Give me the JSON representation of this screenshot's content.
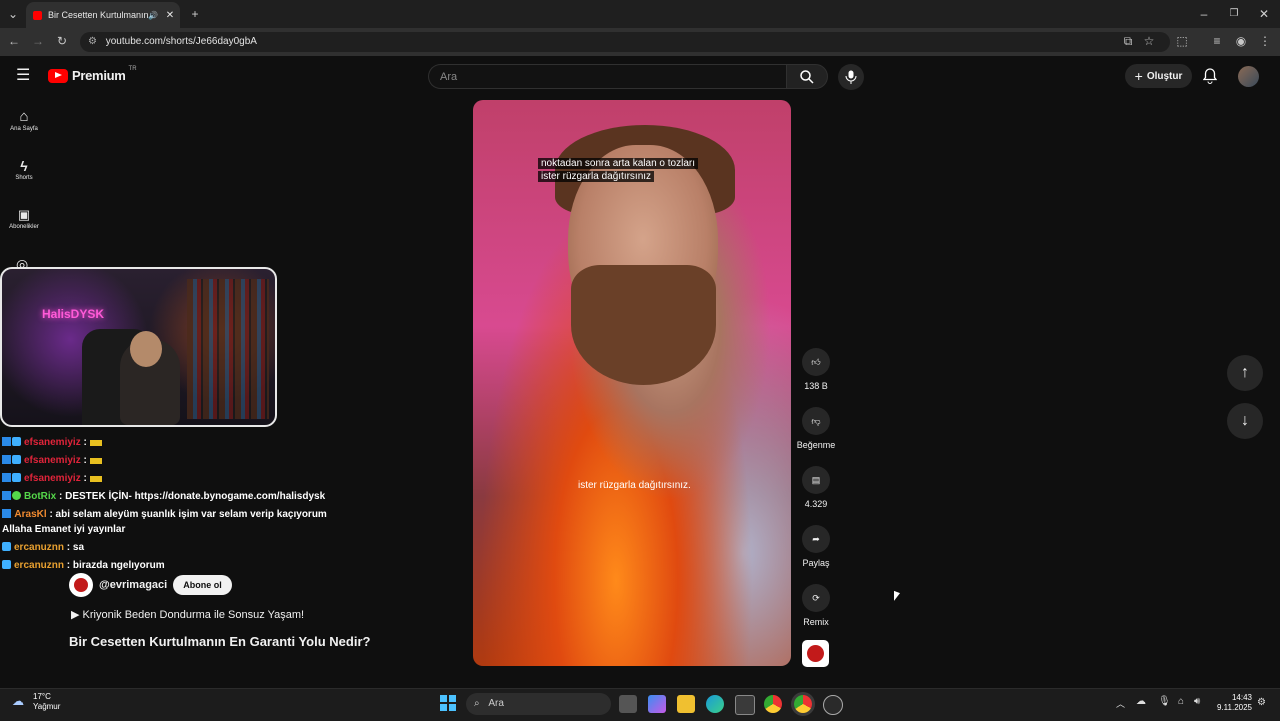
{
  "browser": {
    "tab_title": "Bir Cesetten Kurtulmanın En",
    "url": "youtube.com/shorts/Je66day0gbA"
  },
  "youtube": {
    "logo_text": "Premium",
    "region": "TR",
    "search_placeholder": "Ara",
    "create_label": "Oluştur",
    "nav": [
      {
        "label": "Ana Sayfa",
        "icon": "home-icon"
      },
      {
        "label": "Shorts",
        "icon": "shorts-icon"
      },
      {
        "label": "Abonelikler",
        "icon": "subscriptions-icon"
      }
    ]
  },
  "stream_overlay": {
    "webcam_sign": "HalisDYSK",
    "chat": [
      {
        "user": "efsanemiyiz",
        "user_color": "#e0243a",
        "message": ":"
      },
      {
        "user": "efsanemiyiz",
        "user_color": "#e0243a",
        "message": ":"
      },
      {
        "user": "efsanemiyiz",
        "user_color": "#e0243a",
        "message": ":"
      },
      {
        "user": "BotRix",
        "user_color": "#55d84a",
        "message": ": DESTEK İÇİN- https://donate.bynogame.com/halisdysk"
      },
      {
        "user": "ArasKl",
        "user_color": "#f08a30",
        "message": ": abi selam aleyüm şuanlık işim var selam verip kaçıyorum"
      },
      {
        "user": "",
        "user_color": "#ffffff",
        "message": "Allaha Emanet iyi yayınlar"
      },
      {
        "user": "ercanuznn",
        "user_color": "#e8a030",
        "message": ": sa"
      },
      {
        "user": "ercanuznn",
        "user_color": "#e8a030",
        "message": ": birazda ngelıyorum"
      }
    ]
  },
  "short": {
    "caption_top_line1": "noktadan sonra arta kalan o tozları",
    "caption_top_line2": "ister rüzgarla dağıtırsınız",
    "caption_bottom": "ister rüzgarla dağıtırsınız.",
    "channel": "@evrimagaci",
    "subscribe_label": "Abone ol",
    "suggestion": "▶ Kriyonik Beden Dondurma ile Sonsuz Yaşam!",
    "title": "Bir Cesetten Kurtulmanın En Garanti Yolu Nedir?",
    "actions": {
      "like_count": "138 B",
      "dislike_label": "Beğenme",
      "comment_count": "4.329",
      "share_label": "Paylaş",
      "remix_label": "Remix"
    }
  },
  "taskbar": {
    "temperature": "17°C",
    "weather": "Yağmur",
    "search_placeholder": "Ara",
    "time": "14:43",
    "date": "9.11.2025"
  }
}
